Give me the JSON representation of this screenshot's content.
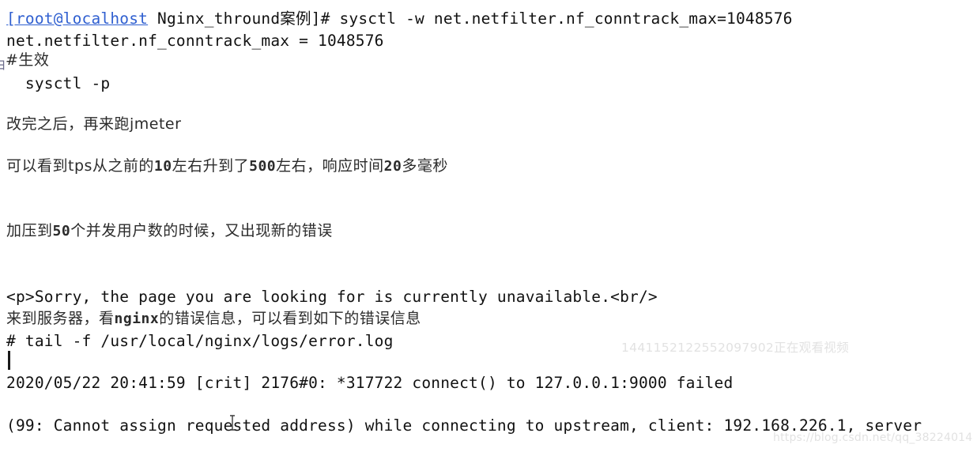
{
  "document": {
    "background_color": "#ffffff",
    "text_color": "#111111",
    "link_color": "#2f5fd0",
    "watermark_color": "#e2e2e2"
  },
  "lines": {
    "prompt_host": "[root@localhost",
    "prompt_rest": " Nginx_thround案例]# sysctl -w net.netfilter.nf_conntrack_max=1048576",
    "sysctl_output": "net.netfilter.nf_conntrack_max = 1048576",
    "comment_effective": "#生效",
    "sysctl_p": "  sysctl -p",
    "note_after_edit": "改完之后，再来跑jmeter",
    "note_tps_1": "可以看到tps从之前的",
    "note_tps_num1": "10",
    "note_tps_2": "左右升到了",
    "note_tps_num2": "500",
    "note_tps_3": "左右，响应时间",
    "note_tps_num3": "20",
    "note_tps_4": "多毫秒",
    "note_pressure_1": "加压到",
    "note_pressure_num": "50",
    "note_pressure_2": "个并发用户数的时候，又出现新的错误",
    "html_snippet": "<p>Sorry, the page you are looking for is currently unavailable.<br/>",
    "note_server_1": "来到服务器，看",
    "note_server_lat": "nginx",
    "note_server_2": "的错误信息，可以看到如下的错误信息",
    "tail_command": "# tail -f /usr/local/nginx/logs/error.log",
    "log_line_1": "2020/05/22 20:41:59 [crit] 2176#0: *317722 connect() to 127.0.0.1:9000 failed",
    "log_line_2": "(99: Cannot assign requested address) while connecting to upstream, client: 192.168.226.1, server"
  },
  "watermarks": {
    "center": "1441152122552097902正在观看视频",
    "corner": "https://blog.csdn.net/qq_38224014"
  },
  "edge": {
    "clipped_glyph": "由"
  }
}
